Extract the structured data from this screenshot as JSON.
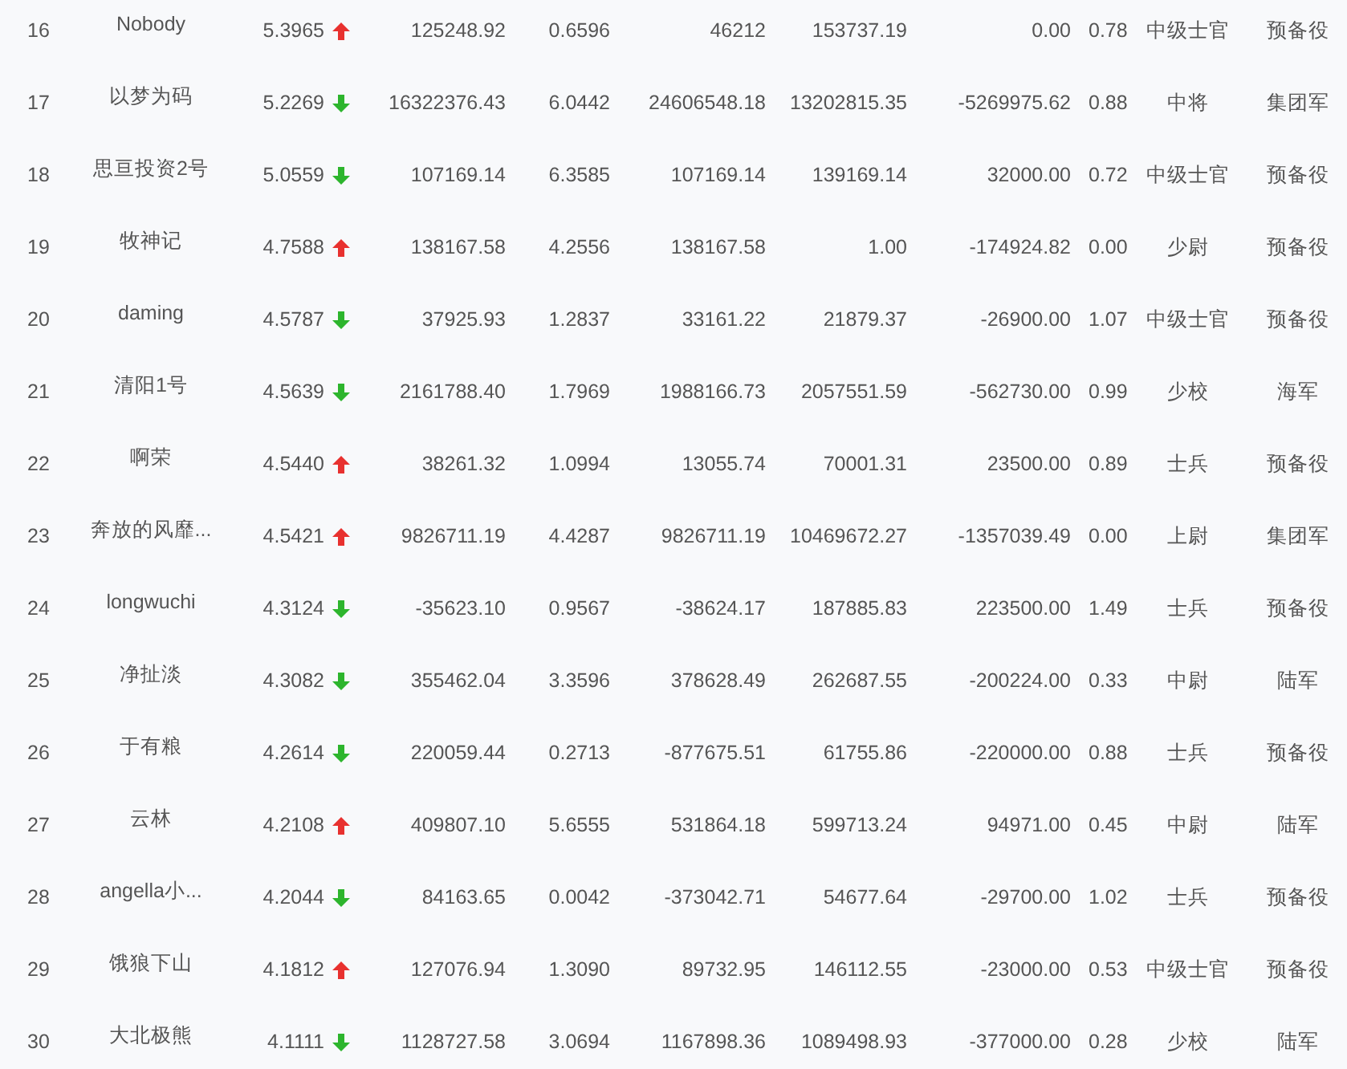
{
  "table": {
    "rows": [
      {
        "cells": [
          "16",
          "Nobody",
          "5.3965",
          "125248.92",
          "0.6596",
          "46212",
          "153737.19",
          "0.00",
          "0.78",
          "中级士官",
          "预备役"
        ],
        "rising": true
      },
      {
        "cells": [
          "17",
          "以梦为码",
          "5.2269",
          "16322376.43",
          "6.0442",
          "24606548.18",
          "13202815.35",
          "-5269975.62",
          "0.88",
          "中将",
          "集团军"
        ],
        "rising": false
      },
      {
        "cells": [
          "18",
          "思亘投资2号",
          "5.0559",
          "107169.14",
          "6.3585",
          "107169.14",
          "139169.14",
          "32000.00",
          "0.72",
          "中级士官",
          "预备役"
        ],
        "rising": false
      },
      {
        "cells": [
          "19",
          "牧神记",
          "4.7588",
          "138167.58",
          "4.2556",
          "138167.58",
          "1.00",
          "-174924.82",
          "0.00",
          "少尉",
          "预备役"
        ],
        "rising": true
      },
      {
        "cells": [
          "20",
          "daming",
          "4.5787",
          "37925.93",
          "1.2837",
          "33161.22",
          "21879.37",
          "-26900.00",
          "1.07",
          "中级士官",
          "预备役"
        ],
        "rising": false
      },
      {
        "cells": [
          "21",
          "清阳1号",
          "4.5639",
          "2161788.40",
          "1.7969",
          "1988166.73",
          "2057551.59",
          "-562730.00",
          "0.99",
          "少校",
          "海军"
        ],
        "rising": false
      },
      {
        "cells": [
          "22",
          "啊荣",
          "4.5440",
          "38261.32",
          "1.0994",
          "13055.74",
          "70001.31",
          "23500.00",
          "0.89",
          "士兵",
          "预备役"
        ],
        "rising": true
      },
      {
        "cells": [
          "23",
          "奔放的风靡...",
          "4.5421",
          "9826711.19",
          "4.4287",
          "9826711.19",
          "10469672.27",
          "-1357039.49",
          "0.00",
          "上尉",
          "集团军"
        ],
        "rising": true
      },
      {
        "cells": [
          "24",
          "longwuchi",
          "4.3124",
          "-35623.10",
          "0.9567",
          "-38624.17",
          "187885.83",
          "223500.00",
          "1.49",
          "士兵",
          "预备役"
        ],
        "rising": false
      },
      {
        "cells": [
          "25",
          "净扯淡",
          "4.3082",
          "355462.04",
          "3.3596",
          "378628.49",
          "262687.55",
          "-200224.00",
          "0.33",
          "中尉",
          "陆军"
        ],
        "rising": false
      },
      {
        "cells": [
          "26",
          "于有粮",
          "4.2614",
          "220059.44",
          "0.2713",
          "-877675.51",
          "61755.86",
          "-220000.00",
          "0.88",
          "士兵",
          "预备役"
        ],
        "rising": false
      },
      {
        "cells": [
          "27",
          "云林",
          "4.2108",
          "409807.10",
          "5.6555",
          "531864.18",
          "599713.24",
          "94971.00",
          "0.45",
          "中尉",
          "陆军"
        ],
        "rising": true
      },
      {
        "cells": [
          "28",
          "angella小...",
          "4.2044",
          "84163.65",
          "0.0042",
          "-373042.71",
          "54677.64",
          "-29700.00",
          "1.02",
          "士兵",
          "预备役"
        ],
        "rising": false
      },
      {
        "cells": [
          "29",
          "饿狼下山",
          "4.1812",
          "127076.94",
          "1.3090",
          "89732.95",
          "146112.55",
          "-23000.00",
          "0.53",
          "中级士官",
          "预备役"
        ],
        "rising": true
      },
      {
        "cells": [
          "30",
          "大北极熊",
          "4.1111",
          "1128727.58",
          "3.0694",
          "1167898.36",
          "1089498.93",
          "-377000.00",
          "0.28",
          "少校",
          "陆军"
        ],
        "rising": false
      }
    ]
  }
}
